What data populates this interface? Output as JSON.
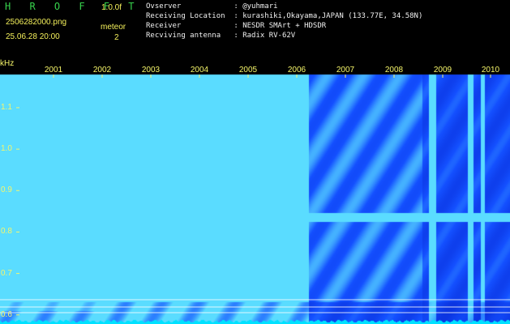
{
  "header": {
    "app_title": "H R O F F T",
    "version": "1.0.0f",
    "filename": "2506282000.png",
    "timestamp": "25.06.28 20:00",
    "mode_label": "meteor",
    "mode_value": "2",
    "info_lines": [
      "Ovserver            : @yuhmari",
      "Receiving Location  : kurashiki,Okayama,JAPAN (133.77E, 34.58N)",
      "Receiver            : NESDR SMArt + HDSDR",
      "Recviving antenna   : Radix RV-62V"
    ]
  },
  "chart_data": {
    "type": "heatmap",
    "unit_label": "kHz",
    "x_labels": [
      "2001",
      "2002",
      "2003",
      "2004",
      "2005",
      "2006",
      "2007",
      "2008",
      "2009",
      "2010"
    ],
    "y_ticks": [
      {
        "label": "1.1",
        "value": 1.1
      },
      {
        "label": "1.0",
        "value": 1.0
      },
      {
        "label": "0.9",
        "value": 0.9
      },
      {
        "label": "0.8",
        "value": 0.8
      },
      {
        "label": "0.7",
        "value": 0.7
      },
      {
        "label": "0.6",
        "value": 0.6
      }
    ],
    "ylim": [
      0.58,
      1.18
    ],
    "colors": {
      "background": "#000000",
      "signal_low": "#000050",
      "signal_high": "#2b36ff",
      "signal_bright": "#58e7ff",
      "trace": "#00e7ff",
      "label": "#f6f66a",
      "grid": "#ffffff"
    }
  }
}
